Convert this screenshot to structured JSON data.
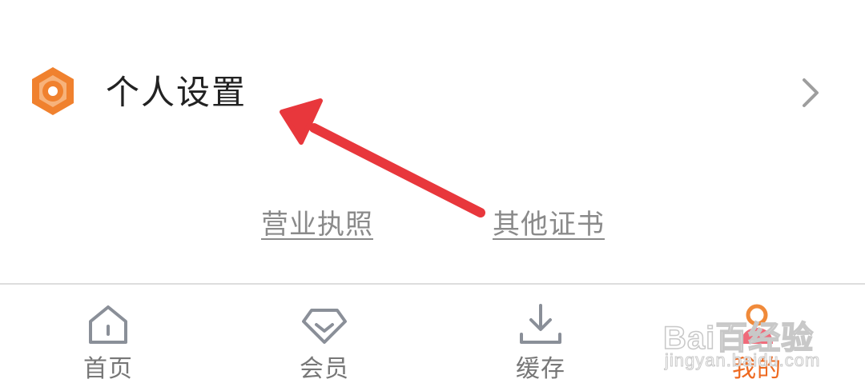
{
  "settings": {
    "label": "个人设置",
    "icon": "gear-hex-icon",
    "accent_color": "#f0812e"
  },
  "links": {
    "business_license": "营业执照",
    "other_certificates": "其他证书"
  },
  "annotation": {
    "color": "#e8373c"
  },
  "tabbar": {
    "items": [
      {
        "label": "首页",
        "icon": "home-icon",
        "active": false
      },
      {
        "label": "会员",
        "icon": "diamond-icon",
        "active": false
      },
      {
        "label": "缓存",
        "icon": "download-icon",
        "active": false
      },
      {
        "label": "我的",
        "icon": "profile-icon",
        "active": true
      }
    ],
    "active_color": "#ee6a21",
    "inactive_color": "#777777"
  },
  "watermark": {
    "main": "Bai百经验",
    "sub": "jingyan.baidu.com"
  }
}
